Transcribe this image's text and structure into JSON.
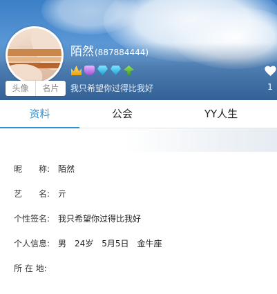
{
  "profile": {
    "name": "陌然",
    "uid": "(887884444)",
    "signature": "我只希望你过得比我好",
    "likes": "1",
    "avatar_tabs": [
      "头像",
      "名片"
    ],
    "badges": [
      "crown-icon",
      "shield-icon",
      "gem-icon",
      "gem-icon",
      "leaf-icon"
    ]
  },
  "tabs": [
    "资料",
    "公会",
    "YY人生"
  ],
  "info": {
    "nickname_label": "昵　　称:",
    "nickname_value": "陌然",
    "stage_label": "艺　　名:",
    "stage_value": "亓",
    "signature_label": "个性签名:",
    "signature_value": "我只希望你过得比我好",
    "personal_label": "个人信息:",
    "personal_value": "男　24岁　5月5日　金牛座",
    "location_label": "所 在 地:",
    "location_value": ""
  },
  "colors": {
    "accent": "#2a90d6",
    "header_blue": "#4a8ad0"
  }
}
